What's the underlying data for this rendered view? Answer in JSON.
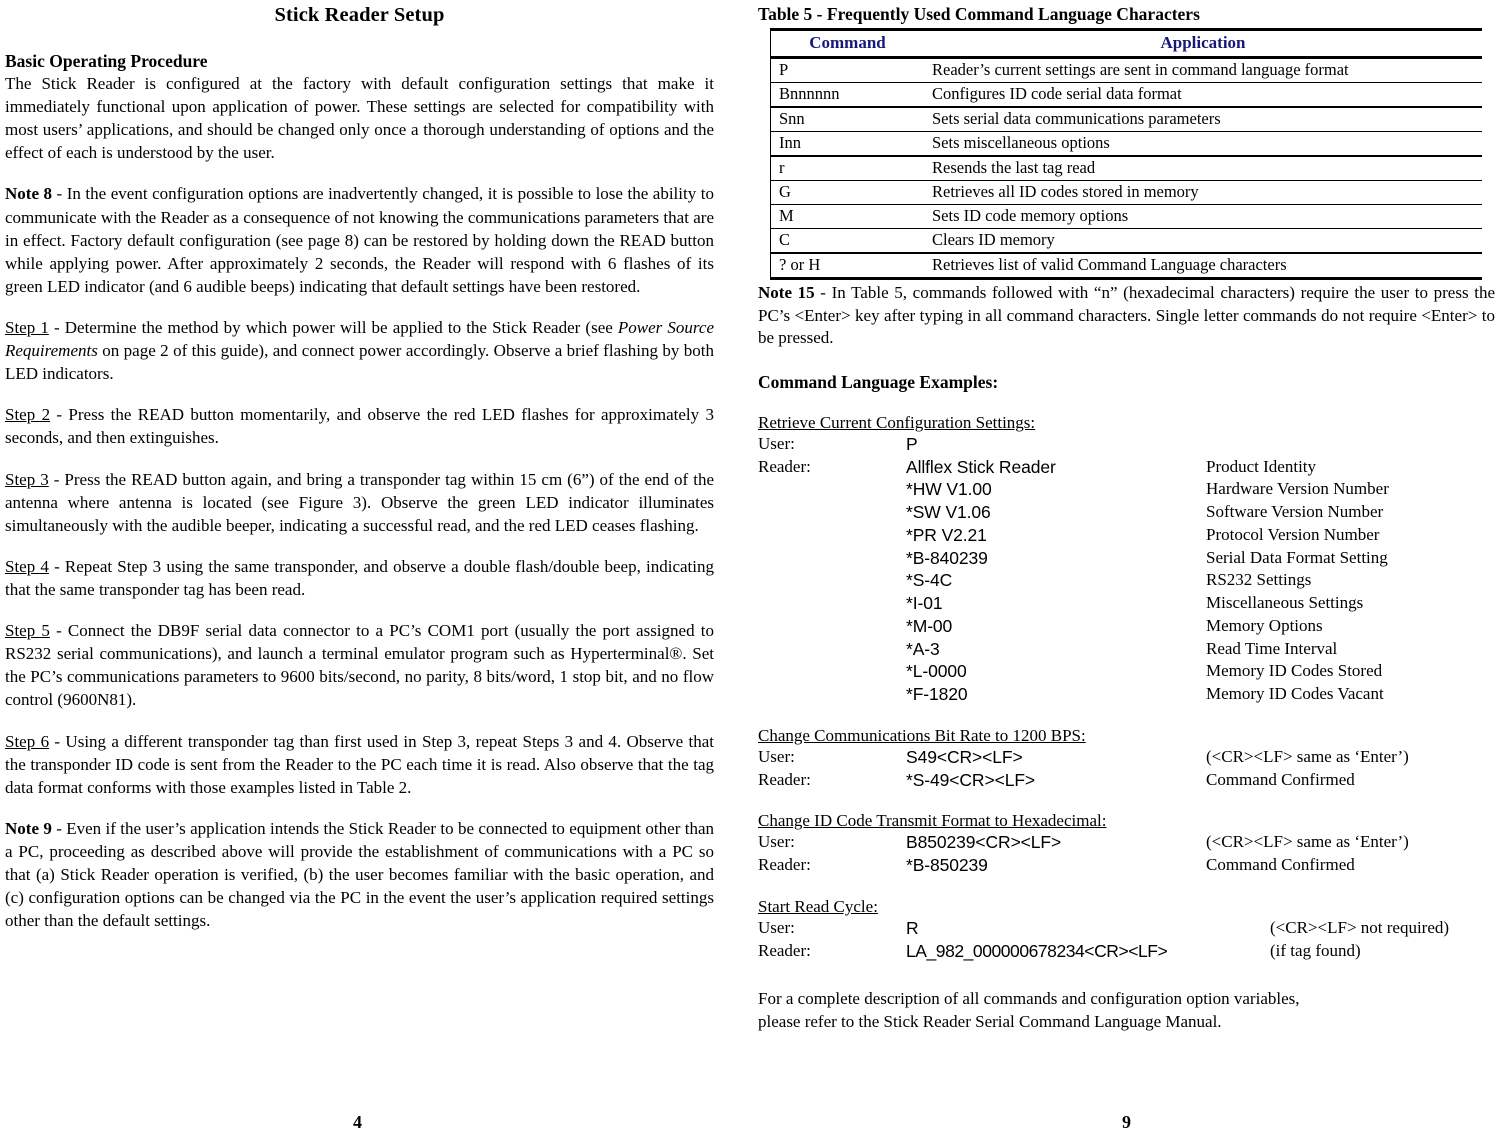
{
  "left_page": {
    "title": "Stick Reader Setup",
    "section_heading": "Basic Operating Procedure",
    "intro_paragraph": "The Stick Reader is configured at the factory with default configuration settings that make it immediately functional upon application of power.  These settings are selected for compatibility with most users’ applications, and should be changed only once a thorough understanding of options and the effect of each is understood by the user.",
    "note8_label": "Note 8",
    "note8_text": "  -  In the event configuration options are inadvertently changed, it is possible to lose the ability to communicate with the Reader as a consequence of not knowing the communications parameters that are in effect.  Factory default configuration (see page 8) can be restored by holding down the READ button while applying power.  After approximately 2 seconds, the Reader will respond with 6 flashes of its green LED indicator (and 6 audible beeps) indicating that default settings have been restored.",
    "step1_label": "Step  1",
    "step1_part1": "  -   Determine the method by which power will be applied to the Stick Reader (see ",
    "step1_italic": "Power Source Requirements",
    "step1_part2": " on page 2 of this guide), and connect power accordingly.  Observe a brief flashing by both LED indicators.",
    "step2_label": "Step  2",
    "step2_text": "  -   Press the READ button momentarily,  and observe the red LED flashes for approximately 3 seconds, and then extinguishes.",
    "step3_label": "Step  3",
    "step3_text": "  -   Press the READ button again, and bring a transponder tag within 15 cm (6”) of the end of the antenna where antenna is located (see Figure 3).   Observe the green LED indicator illuminates simultaneously with the audible beeper, indicating a successful read, and the red LED ceases flashing.",
    "step4_label": "Step  4",
    "step4_text": "   -   Repeat Step 3 using the same transponder, and observe a double flash/double beep, indicating that the same transponder tag has been read.",
    "step5_label": "Step  5",
    "step5_text": "  -   Connect the DB9F serial data connector to a PC’s COM1 port (usually the port assigned to RS232 serial communications), and launch a terminal emulator program such as Hyperterminal®.   Set the PC’s communications parameters to 9600 bits/second, no parity, 8 bits/word, 1 stop bit, and no flow control (9600N81).",
    "step6_label": "Step  6",
    "step6_text": "  -   Using a different transponder tag than first used in Step 3, repeat Steps 3 and 4.   Observe that the transponder ID code is sent from the Reader to the PC each time it is read.   Also observe that the tag data format conforms with those examples listed in Table 2.",
    "note9_label": "Note 9",
    "note9_text": "  -  Even if the user’s application intends the Stick Reader to be connected to equipment other than a PC, proceeding as described above will provide the establishment of communications with a PC so that (a) Stick Reader operation is verified, (b) the user becomes familiar with the basic operation, and (c) configuration options can be changed via the PC in the event the user’s application required settings other than the default settings.",
    "page_number": "4"
  },
  "right_page": {
    "table": {
      "title": "Table 5  -  Frequently Used Command Language Characters",
      "header_color": "#16197a",
      "columns": [
        "Command",
        "Application"
      ],
      "rows": [
        {
          "command": "P",
          "application": "Reader’s current settings are sent in command language format"
        },
        {
          "command": "Bnnnnnn",
          "application": "Configures ID code serial data format"
        },
        {
          "command": "Snn",
          "application": "Sets serial data communications parameters"
        },
        {
          "command": "Inn",
          "application": "Sets miscellaneous options"
        },
        {
          "command": "r",
          "application": "Resends the last tag read"
        },
        {
          "command": "G",
          "application": "Retrieves all ID codes stored in memory"
        },
        {
          "command": "M",
          "application": "Sets ID code memory options"
        },
        {
          "command": "C",
          "application": "Clears ID memory"
        },
        {
          "command": "? or H",
          "application": "Retrieves list of valid Command Language characters"
        }
      ]
    },
    "note15_label": "Note 15",
    "note15_text": "  -  In Table 5, commands followed with “n” (hexadecimal characters) require the user to press the PC’s <Enter> key after typing in all command characters.  Single letter commands do not require <Enter> to be pressed.",
    "examples_heading": "Command Language Examples:",
    "example_groups": [
      {
        "title": "Retrieve Current Configuration Settings:",
        "rows": [
          {
            "label": "User:",
            "value": "P",
            "desc": ""
          },
          {
            "label": "Reader:",
            "value": "Allflex Stick Reader",
            "desc": "Product Identity"
          },
          {
            "label": "",
            "value": "*HW V1.00",
            "desc": "Hardware Version Number"
          },
          {
            "label": "",
            "value": "*SW  V1.06",
            "desc": "Software Version Number"
          },
          {
            "label": "",
            "value": "*PR V2.21",
            "desc": "Protocol Version Number"
          },
          {
            "label": "",
            "value": "*B-840239",
            "desc": "Serial Data Format Setting"
          },
          {
            "label": "",
            "value": "*S-4C",
            "desc": "RS232 Settings"
          },
          {
            "label": "",
            "value": "*I-01",
            "desc": "Miscellaneous Settings"
          },
          {
            "label": "",
            "value": "*M-00",
            "desc": "Memory Options"
          },
          {
            "label": "",
            "value": "*A-3",
            "desc": "Read Time Interval"
          },
          {
            "label": "",
            "value": "*L-0000",
            "desc": "Memory ID Codes Stored"
          },
          {
            "label": "",
            "value": "*F-1820",
            "desc": "Memory ID Codes Vacant"
          }
        ]
      },
      {
        "title": "Change Communications Bit Rate to 1200 BPS:",
        "rows": [
          {
            "label": "User:",
            "value": "S49<CR><LF>",
            "desc": "(<CR><LF> same as ‘Enter’)"
          },
          {
            "label": "Reader:",
            "value": "*S-49<CR><LF>",
            "desc": "Command Confirmed"
          }
        ]
      },
      {
        "title": "Change ID Code Transmit Format to Hexadecimal:",
        "rows": [
          {
            "label": "User:",
            "value": "B850239<CR><LF>",
            "desc": "(<CR><LF> same as ‘Enter’)"
          },
          {
            "label": "Reader:",
            "value": "*B-850239",
            "desc": "Command Confirmed"
          }
        ]
      },
      {
        "title": "Start Read Cycle:",
        "rows": [
          {
            "label": "User:",
            "value": "R",
            "desc": "(<CR><LF> not required)"
          },
          {
            "label": "Reader:",
            "value": "LA_982_000000678234<CR><LF>",
            "desc": "(if tag found)"
          }
        ]
      }
    ],
    "closing_line1": "For a complete description of all commands and configuration option variables,",
    "closing_line2": "please refer to the Stick Reader Serial Command Language Manual.",
    "page_number": "9"
  }
}
